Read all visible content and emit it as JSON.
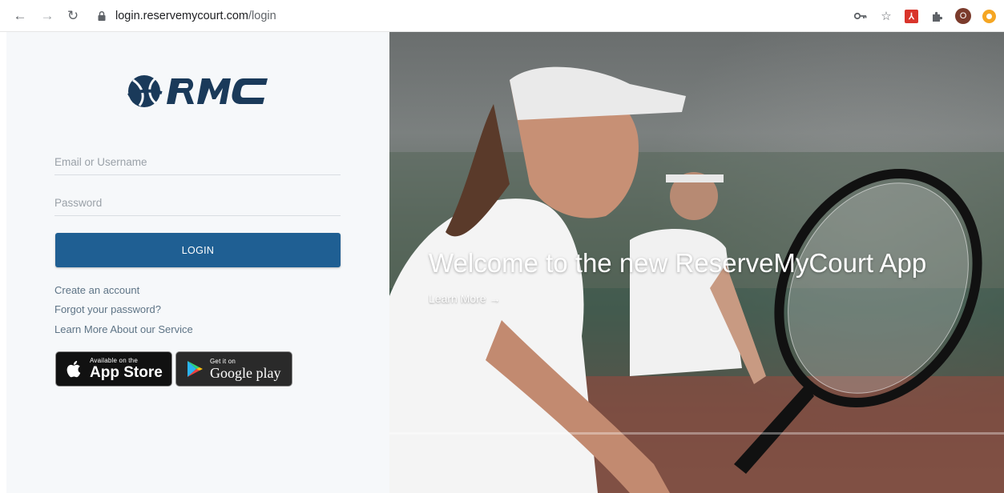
{
  "browser": {
    "url_host": "login.reservemycourt.com",
    "url_path": "/login",
    "profile_initial": "O",
    "icons": [
      "back-icon",
      "forward-icon",
      "reload-icon",
      "lock-icon",
      "key-icon",
      "star-icon",
      "pdf-extension-icon",
      "puzzle-icon",
      "profile-avatar",
      "extension-circle-icon"
    ]
  },
  "login": {
    "logo_text": "RMC",
    "email_placeholder": "Email or Username",
    "password_placeholder": "Password",
    "login_label": "LOGIN",
    "links": [
      "Create an account",
      "Forgot your password?",
      "Learn More About our Service"
    ],
    "appstore_small": "Available on the",
    "appstore_big": "App Store",
    "gplay_small": "Get it on",
    "gplay_big": "Google play"
  },
  "hero": {
    "welcome": "Welcome to the new ReserveMyCourt App",
    "learn_more": "Learn More →"
  },
  "colors": {
    "primary": "#1f5f93",
    "logo": "#1a3a5a",
    "link": "#5e7486",
    "panel_bg": "#f6f8fa"
  }
}
